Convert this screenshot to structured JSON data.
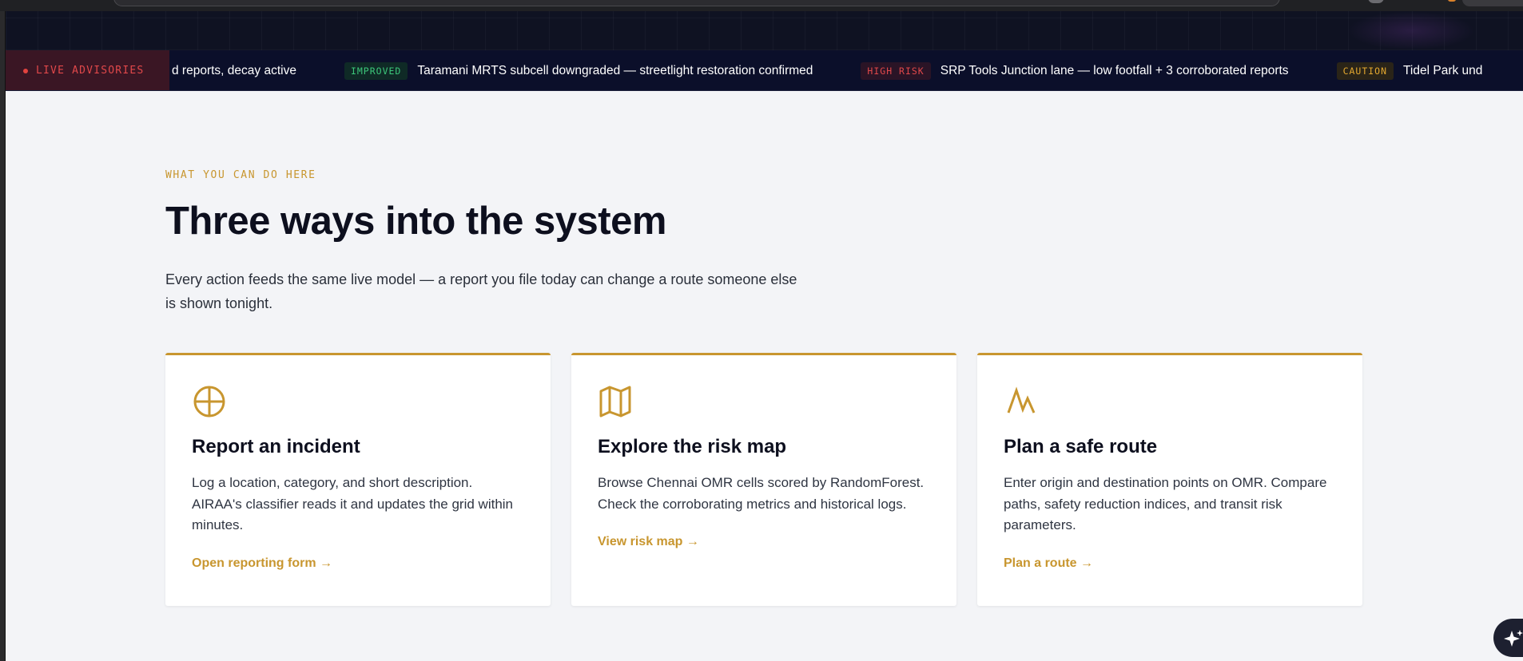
{
  "ticker": {
    "label": "LIVE ADVISORIES",
    "items": [
      {
        "badge": "",
        "text": "d reports, decay active"
      },
      {
        "badge": "IMPROVED",
        "text": "Taramani MRTS subcell downgraded — streetlight restoration confirmed"
      },
      {
        "badge": "HIGH RISK",
        "text": "SRP Tools Junction lane — low footfall + 3 corroborated reports"
      },
      {
        "badge": "CAUTION",
        "text": "Tidel Park und"
      }
    ]
  },
  "section": {
    "eyebrow": "WHAT YOU CAN DO HERE",
    "title": "Three ways into the system",
    "lede": "Every action feeds the same live model — a report you file today can change a route someone else is shown tonight."
  },
  "cards": [
    {
      "icon": "crosshair-icon",
      "title": "Report an incident",
      "desc": "Log a location, category, and short description. AIRAA's classifier reads it and updates the grid within minutes.",
      "link": "Open reporting form →"
    },
    {
      "icon": "map-icon",
      "title": "Explore the risk map",
      "desc": "Browse Chennai OMR cells scored by RandomForest. Check the corroborating metrics and historical logs.",
      "link": "View risk map →"
    },
    {
      "icon": "route-icon",
      "title": "Plan a safe route",
      "desc": "Enter origin and destination points on OMR. Compare paths, safety reduction indices, and transit risk parameters.",
      "link": "Plan a route →"
    }
  ],
  "colors": {
    "accent": "#c8962f",
    "ticker_bg": "#0b0f2a",
    "improved": "#3cc77a",
    "high_risk": "#e0484a",
    "caution": "#e3a72f",
    "page_bg": "#f3f4f7"
  },
  "fab": {
    "icon": "sparkle-icon"
  }
}
